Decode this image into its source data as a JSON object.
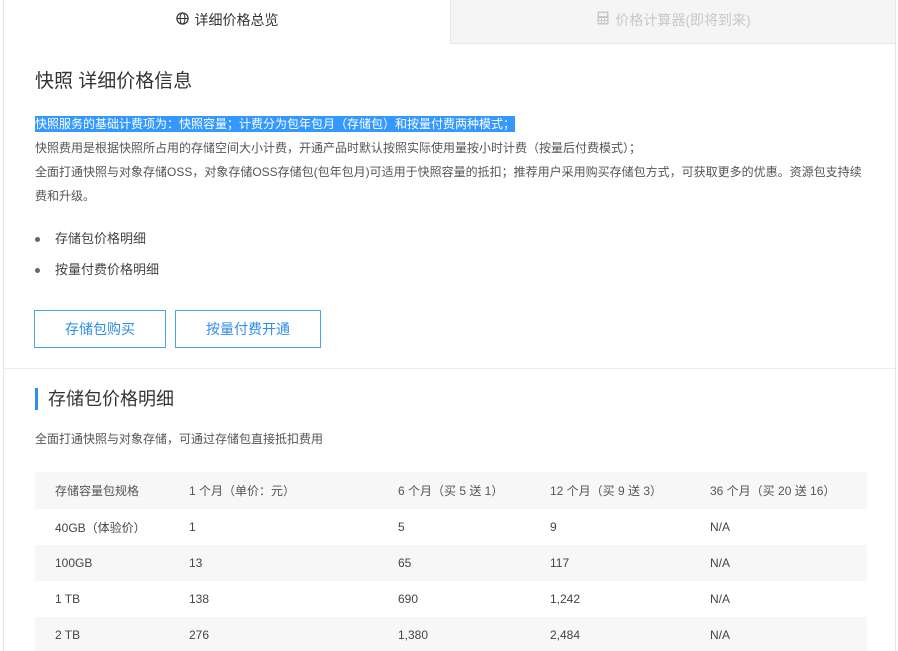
{
  "tabs": [
    {
      "label": "详细价格总览",
      "icon": "globe-icon",
      "active": true
    },
    {
      "label": "价格计算器(即将到来)",
      "icon": "calculator-icon",
      "active": false
    }
  ],
  "page_title": "快照 详细价格信息",
  "intro": {
    "line1": "快照服务的基础计费项为：快照容量；计费分为包年包月（存储包）和按量付费两种模式；",
    "line2": "快照费用是根据快照所占用的存储空间大小计费，开通产品时默认按照实际使用量按小时计费（按量后付费模式）；",
    "line3a": "全面打通快照与对象存储OSS，对象存储OSS存储包(包年包月)可适用于快照容量的抵扣；推荐用户采用购买存储包方式，可获取更多的优惠。资源包支持续",
    "line3b": "费和升级。"
  },
  "links": [
    "存储包价格明细",
    "按量付费价格明细"
  ],
  "buttons": {
    "buy_package": "存储包购买",
    "pay_as_you_go": "按量付费开通"
  },
  "section": {
    "title": "存储包价格明细",
    "desc": "全面打通快照与对象存储，可通过存储包直接抵扣费用"
  },
  "table": {
    "headers": [
      "存储容量包规格",
      "1 个月（单价：元）",
      "6 个月（买 5 送 1）",
      "12 个月（买 9 送 3）",
      "36 个月（买 20 送 16）"
    ],
    "rows": [
      [
        "40GB（体验价）",
        "1",
        "5",
        "9",
        "N/A"
      ],
      [
        "100GB",
        "13",
        "65",
        "117",
        "N/A"
      ],
      [
        "1 TB",
        "138",
        "690",
        "1,242",
        "N/A"
      ],
      [
        "2 TB",
        "276",
        "1,380",
        "2,484",
        "N/A"
      ]
    ]
  },
  "colors": {
    "accent": "#2f8ee8",
    "highlight": "#3399ff"
  }
}
